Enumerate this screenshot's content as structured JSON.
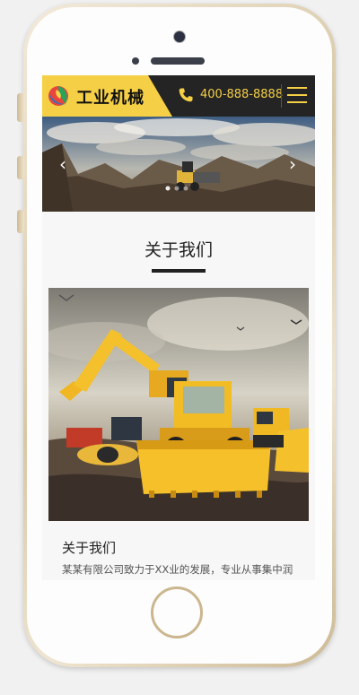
{
  "header": {
    "brand_name": "工业机械",
    "logo_icon": "colorful-leaf-logo",
    "phone_number": "400-888-8888",
    "phone_icon": "phone-icon",
    "menu_icon": "hamburger-menu-icon",
    "accent_color": "#f5cf45",
    "bar_color": "#242424"
  },
  "banner": {
    "prev_icon": "chevron-left-icon",
    "next_icon": "chevron-right-icon",
    "prev_glyph": "‹",
    "next_glyph": "›"
  },
  "about": {
    "section_title": "关于我们",
    "card_title": "关于我们",
    "card_text": "某某有限公司致力于XX业的发展，专业从事集中润"
  }
}
